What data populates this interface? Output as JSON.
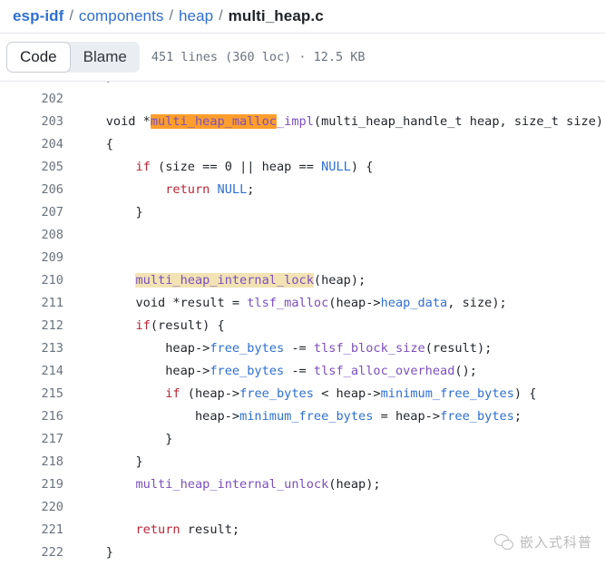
{
  "breadcrumb": {
    "separator": "/",
    "items": [
      {
        "label": "esp-idf",
        "kind": "root"
      },
      {
        "label": "components",
        "kind": "link"
      },
      {
        "label": "heap",
        "kind": "link"
      },
      {
        "label": "multi_heap.c",
        "kind": "current"
      }
    ]
  },
  "toolbar": {
    "code_tab": "Code",
    "blame_tab": "Blame",
    "file_meta": "451 lines (360 loc) · 12.5 KB",
    "lines_total": "451",
    "loc": "360",
    "file_size": "12.5 KB"
  },
  "colors": {
    "link": "#2f6fd0",
    "keyword": "#b92638",
    "function": "#7b4fbd",
    "member": "#2f6fd0",
    "highlight_strong": "#ff9e2c",
    "highlight_soft": "#f2e3b4",
    "line_number": "#6a737d",
    "text": "#1f2328"
  },
  "code": {
    "language": "c",
    "first_visible_line": 202,
    "last_visible_line": 222,
    "clipped_top_line": {
      "number": 201,
      "tokens": [
        {
          "t": "    }",
          "c": "txt"
        }
      ]
    },
    "lines": [
      {
        "n": 202,
        "tokens": []
      },
      {
        "n": 203,
        "tokens": [
          {
            "t": "    void *",
            "c": "txt"
          },
          {
            "t": "multi_heap_malloc",
            "c": "fn",
            "hl": "strong"
          },
          {
            "t": "_impl",
            "c": "fn"
          },
          {
            "t": "(multi_heap_handle_t heap, size_t size)",
            "c": "txt"
          }
        ]
      },
      {
        "n": 204,
        "tokens": [
          {
            "t": "    {",
            "c": "txt"
          }
        ]
      },
      {
        "n": 205,
        "tokens": [
          {
            "t": "        ",
            "c": "txt"
          },
          {
            "t": "if",
            "c": "kw"
          },
          {
            "t": " (size == 0 || heap == ",
            "c": "txt"
          },
          {
            "t": "NULL",
            "c": "mem"
          },
          {
            "t": ") {",
            "c": "txt"
          }
        ]
      },
      {
        "n": 206,
        "tokens": [
          {
            "t": "            ",
            "c": "txt"
          },
          {
            "t": "return",
            "c": "kw"
          },
          {
            "t": " ",
            "c": "txt"
          },
          {
            "t": "NULL",
            "c": "mem"
          },
          {
            "t": ";",
            "c": "txt"
          }
        ]
      },
      {
        "n": 207,
        "tokens": [
          {
            "t": "        }",
            "c": "txt"
          }
        ]
      },
      {
        "n": 208,
        "tokens": []
      },
      {
        "n": 209,
        "tokens": []
      },
      {
        "n": 210,
        "tokens": [
          {
            "t": "        ",
            "c": "txt"
          },
          {
            "t": "multi_heap_internal_lock",
            "c": "fn",
            "hl": "soft"
          },
          {
            "t": "(heap);",
            "c": "txt"
          }
        ]
      },
      {
        "n": 211,
        "tokens": [
          {
            "t": "        void *result = ",
            "c": "txt"
          },
          {
            "t": "tlsf_malloc",
            "c": "fn"
          },
          {
            "t": "(heap->",
            "c": "txt"
          },
          {
            "t": "heap_data",
            "c": "mem"
          },
          {
            "t": ", size);",
            "c": "txt"
          }
        ]
      },
      {
        "n": 212,
        "tokens": [
          {
            "t": "        ",
            "c": "txt"
          },
          {
            "t": "if",
            "c": "kw"
          },
          {
            "t": "(result) {",
            "c": "txt"
          }
        ]
      },
      {
        "n": 213,
        "tokens": [
          {
            "t": "            heap->",
            "c": "txt"
          },
          {
            "t": "free_bytes",
            "c": "mem"
          },
          {
            "t": " -= ",
            "c": "txt"
          },
          {
            "t": "tlsf_block_size",
            "c": "fn"
          },
          {
            "t": "(result);",
            "c": "txt"
          }
        ]
      },
      {
        "n": 214,
        "tokens": [
          {
            "t": "            heap->",
            "c": "txt"
          },
          {
            "t": "free_bytes",
            "c": "mem"
          },
          {
            "t": " -= ",
            "c": "txt"
          },
          {
            "t": "tlsf_alloc_overhead",
            "c": "fn"
          },
          {
            "t": "();",
            "c": "txt"
          }
        ]
      },
      {
        "n": 215,
        "tokens": [
          {
            "t": "            ",
            "c": "txt"
          },
          {
            "t": "if",
            "c": "kw"
          },
          {
            "t": " (heap->",
            "c": "txt"
          },
          {
            "t": "free_bytes",
            "c": "mem"
          },
          {
            "t": " < heap->",
            "c": "txt"
          },
          {
            "t": "minimum_free_bytes",
            "c": "mem"
          },
          {
            "t": ") {",
            "c": "txt"
          }
        ]
      },
      {
        "n": 216,
        "tokens": [
          {
            "t": "                heap->",
            "c": "txt"
          },
          {
            "t": "minimum_free_bytes",
            "c": "mem"
          },
          {
            "t": " = heap->",
            "c": "txt"
          },
          {
            "t": "free_bytes",
            "c": "mem"
          },
          {
            "t": ";",
            "c": "txt"
          }
        ]
      },
      {
        "n": 217,
        "tokens": [
          {
            "t": "            }",
            "c": "txt"
          }
        ]
      },
      {
        "n": 218,
        "tokens": [
          {
            "t": "        }",
            "c": "txt"
          }
        ]
      },
      {
        "n": 219,
        "tokens": [
          {
            "t": "        ",
            "c": "txt"
          },
          {
            "t": "multi_heap_internal_unlock",
            "c": "fn"
          },
          {
            "t": "(heap);",
            "c": "txt"
          }
        ]
      },
      {
        "n": 220,
        "tokens": []
      },
      {
        "n": 221,
        "tokens": [
          {
            "t": "        ",
            "c": "txt"
          },
          {
            "t": "return",
            "c": "kw"
          },
          {
            "t": " result;",
            "c": "txt"
          }
        ]
      },
      {
        "n": 222,
        "tokens": [
          {
            "t": "    }",
            "c": "txt"
          }
        ]
      }
    ]
  },
  "watermark": {
    "text": "嵌入式科普",
    "icon": "wechat-icon"
  }
}
